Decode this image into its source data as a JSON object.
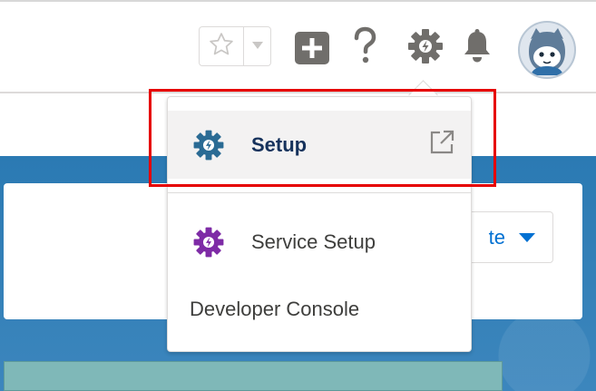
{
  "header": {
    "favorites_star_icon": "star-outline-icon",
    "favorites_caret_icon": "caret-down-icon",
    "global_actions_icon": "plus-square-icon",
    "help_icon": "question-icon",
    "setup_icon": "gear-bolt-icon",
    "notifications_icon": "bell-icon",
    "avatar_icon": "astro-avatar"
  },
  "setup_menu": {
    "items": [
      {
        "label": "Setup",
        "icon": "gear-bolt-icon",
        "icon_color": "#2a6b94",
        "trailing_icon": "external-link-icon"
      },
      {
        "label": "Service Setup",
        "icon": "gear-bolt-icon",
        "icon_color": "#7e2ba6"
      },
      {
        "label": "Developer Console"
      }
    ]
  },
  "background_page": {
    "button_partial_label": "te"
  },
  "colors": {
    "highlight": "#e60000",
    "brand_blue": "#0070d2",
    "header_icon_gray": "#706e6b"
  }
}
